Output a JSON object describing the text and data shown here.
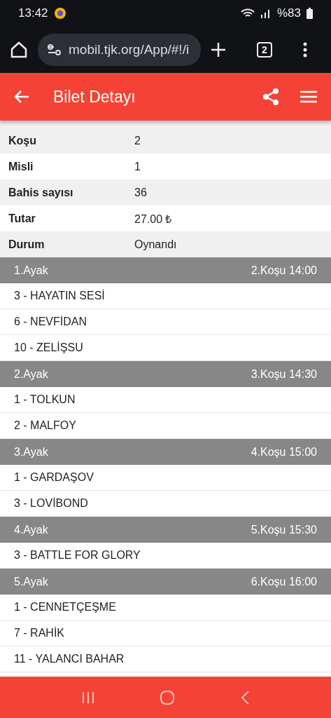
{
  "status_bar": {
    "time": "13:42",
    "battery": "%83"
  },
  "browser": {
    "url": "mobil.tjk.org/App/#!/i",
    "tab_count": "2"
  },
  "app_bar": {
    "title": "Bilet Detayı"
  },
  "details": [
    {
      "label": "Koşu",
      "value": "2"
    },
    {
      "label": "Misli",
      "value": "1"
    },
    {
      "label": "Bahis sayısı",
      "value": "36"
    },
    {
      "label": "Tutar",
      "value": "27.00 ₺"
    },
    {
      "label": "Durum",
      "value": "Oynandı"
    }
  ],
  "legs": [
    {
      "leg": "1.Ayak",
      "race": "2.Koşu 14:00",
      "horses": [
        "3 - HAYATIN SESİ",
        "6 - NEVFİDAN",
        "10 - ZELİŞSU"
      ]
    },
    {
      "leg": "2.Ayak",
      "race": "3.Koşu 14:30",
      "horses": [
        "1 - TOLKUN",
        "2 - MALFOY"
      ]
    },
    {
      "leg": "3.Ayak",
      "race": "4.Koşu 15:00",
      "horses": [
        "1 - GARDAŞOV",
        "3 - LOVİBOND"
      ]
    },
    {
      "leg": "4.Ayak",
      "race": "5.Koşu 15:30",
      "horses": [
        "3 - BATTLE FOR GLORY"
      ]
    },
    {
      "leg": "5.Ayak",
      "race": "6.Koşu 16:00",
      "horses": [
        "1 - CENNETÇEŞME",
        "7 - RAHİK",
        "11 - YALANCI BAHAR"
      ]
    }
  ]
}
